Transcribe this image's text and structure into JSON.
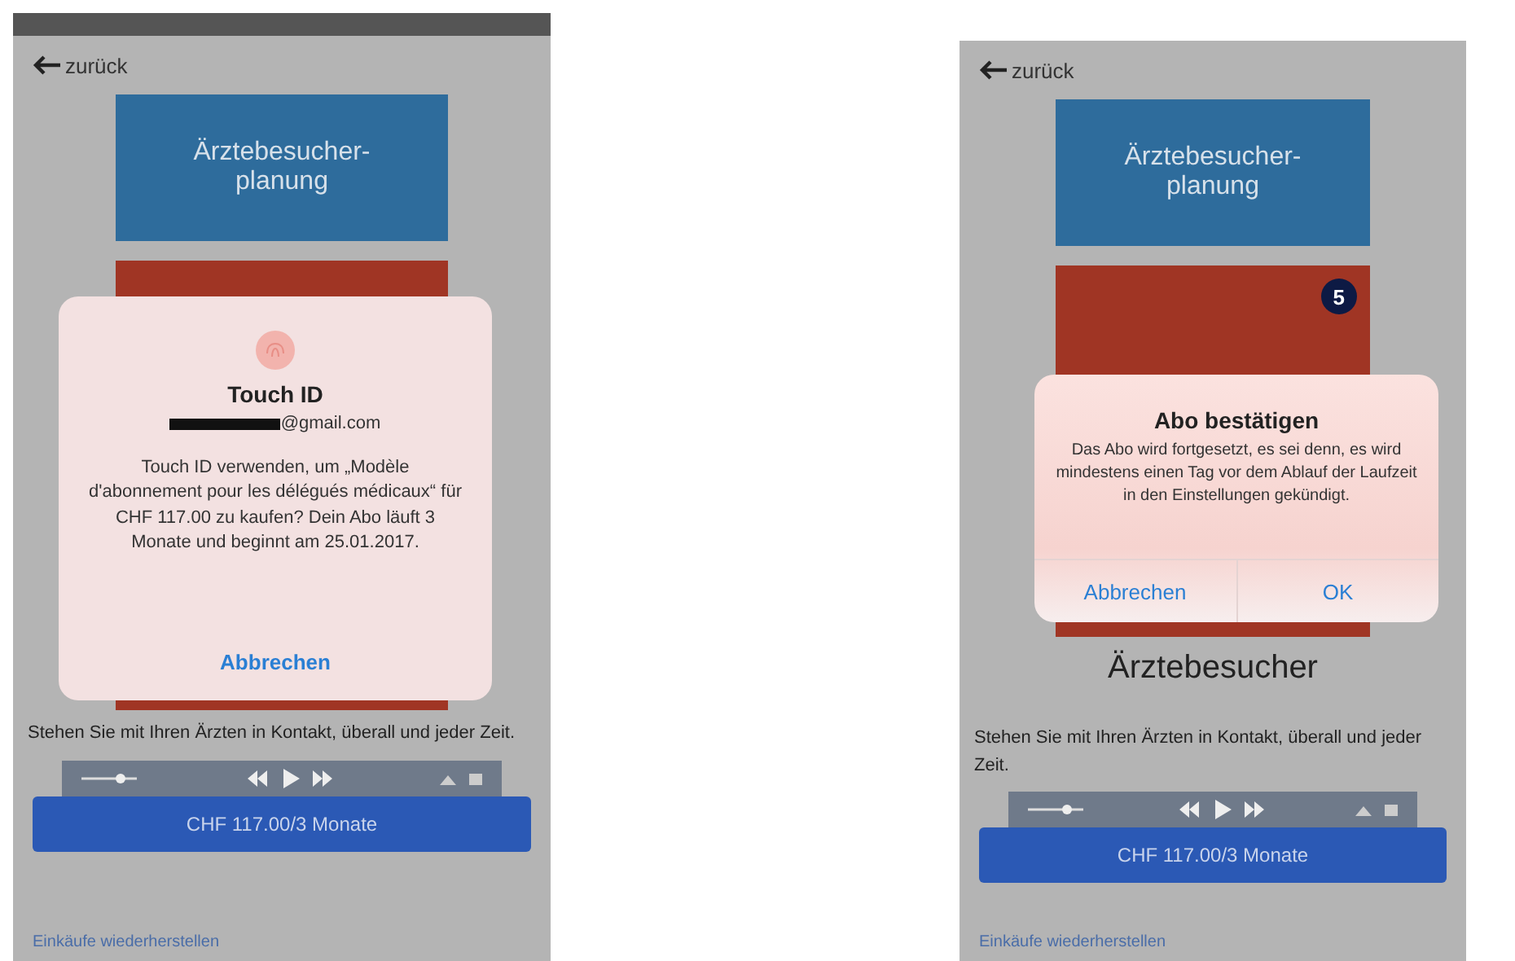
{
  "screens": [
    {
      "has_status_bar": true,
      "back_label": "zurück",
      "tile_title": "Ärztebesucher-planung",
      "dialog": {
        "kind": "touch_id",
        "title": "Touch ID",
        "account": "@gmail.com",
        "message": "Touch ID verwenden, um „Modèle d'abonnement pour les délégués médicaux“ für CHF 117.00 zu kaufen? Dein Abo läuft 3 Monate und beginnt am 25.01.2017.",
        "buttons": [
          "Abbrechen"
        ]
      },
      "description": "Stehen Sie mit Ihren Ärzten in Kontakt, überall und jeder Zeit.",
      "price_button": "CHF 117.00/3 Monate",
      "restore_link": "Einkäufe wiederherstellen"
    },
    {
      "has_status_bar": false,
      "back_label": "zurück",
      "tile_title": "Ärztebesucher-planung",
      "badge": "5",
      "app_title": "Ärztebesucher",
      "dialog": {
        "kind": "confirm",
        "title": "Abo bestätigen",
        "message": "Das Abo wird fortgesetzt, es sei denn, es wird mindestens einen Tag vor dem Ablauf der Laufzeit in den Einstellungen gekündigt.",
        "buttons": [
          "Abbrechen",
          "OK"
        ]
      },
      "description": "Stehen Sie mit Ihren Ärzten in Kontakt, überall und jeder Zeit.",
      "price_button": "CHF 117.00/3 Monate",
      "restore_link": "Einkäufe wiederherstellen"
    }
  ]
}
